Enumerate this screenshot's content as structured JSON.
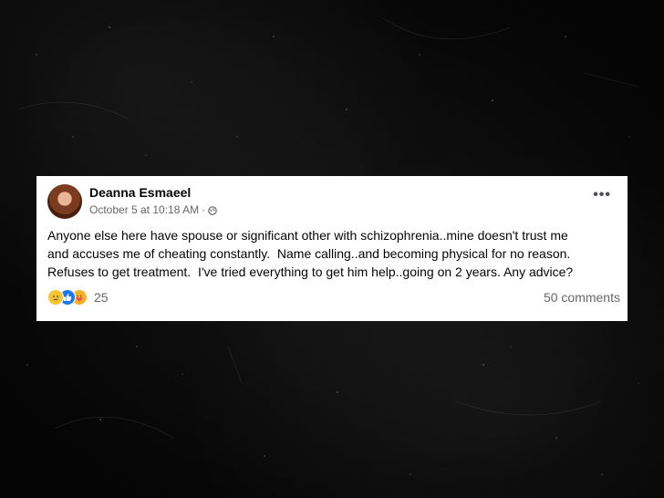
{
  "post": {
    "author": "Deanna Esmaeel",
    "timestamp": "October 5 at 10:18 AM",
    "separator": "·",
    "privacy_icon": "globe-icon",
    "more_icon": "more-options-icon",
    "more_label": "•••",
    "text": "Anyone else here have spouse or significant other with schizophrenia..mine doesn't trust me\nand accuses me of cheating constantly.  Name calling..and becoming physical for no reason.\nRefuses to get treatment.  I've tried everything to get him help..going on 2 years. Any advice?",
    "reactions": {
      "icons": [
        "sad-reaction-icon",
        "like-reaction-icon",
        "care-reaction-icon"
      ],
      "count": "25"
    },
    "comments": "50 comments"
  },
  "colors": {
    "background": "#0b0b0b",
    "card": "#ffffff",
    "text": "#050505",
    "secondary_text": "#65676b",
    "like_blue": "#1877f2",
    "reaction_yellow": "#f7c42f"
  }
}
